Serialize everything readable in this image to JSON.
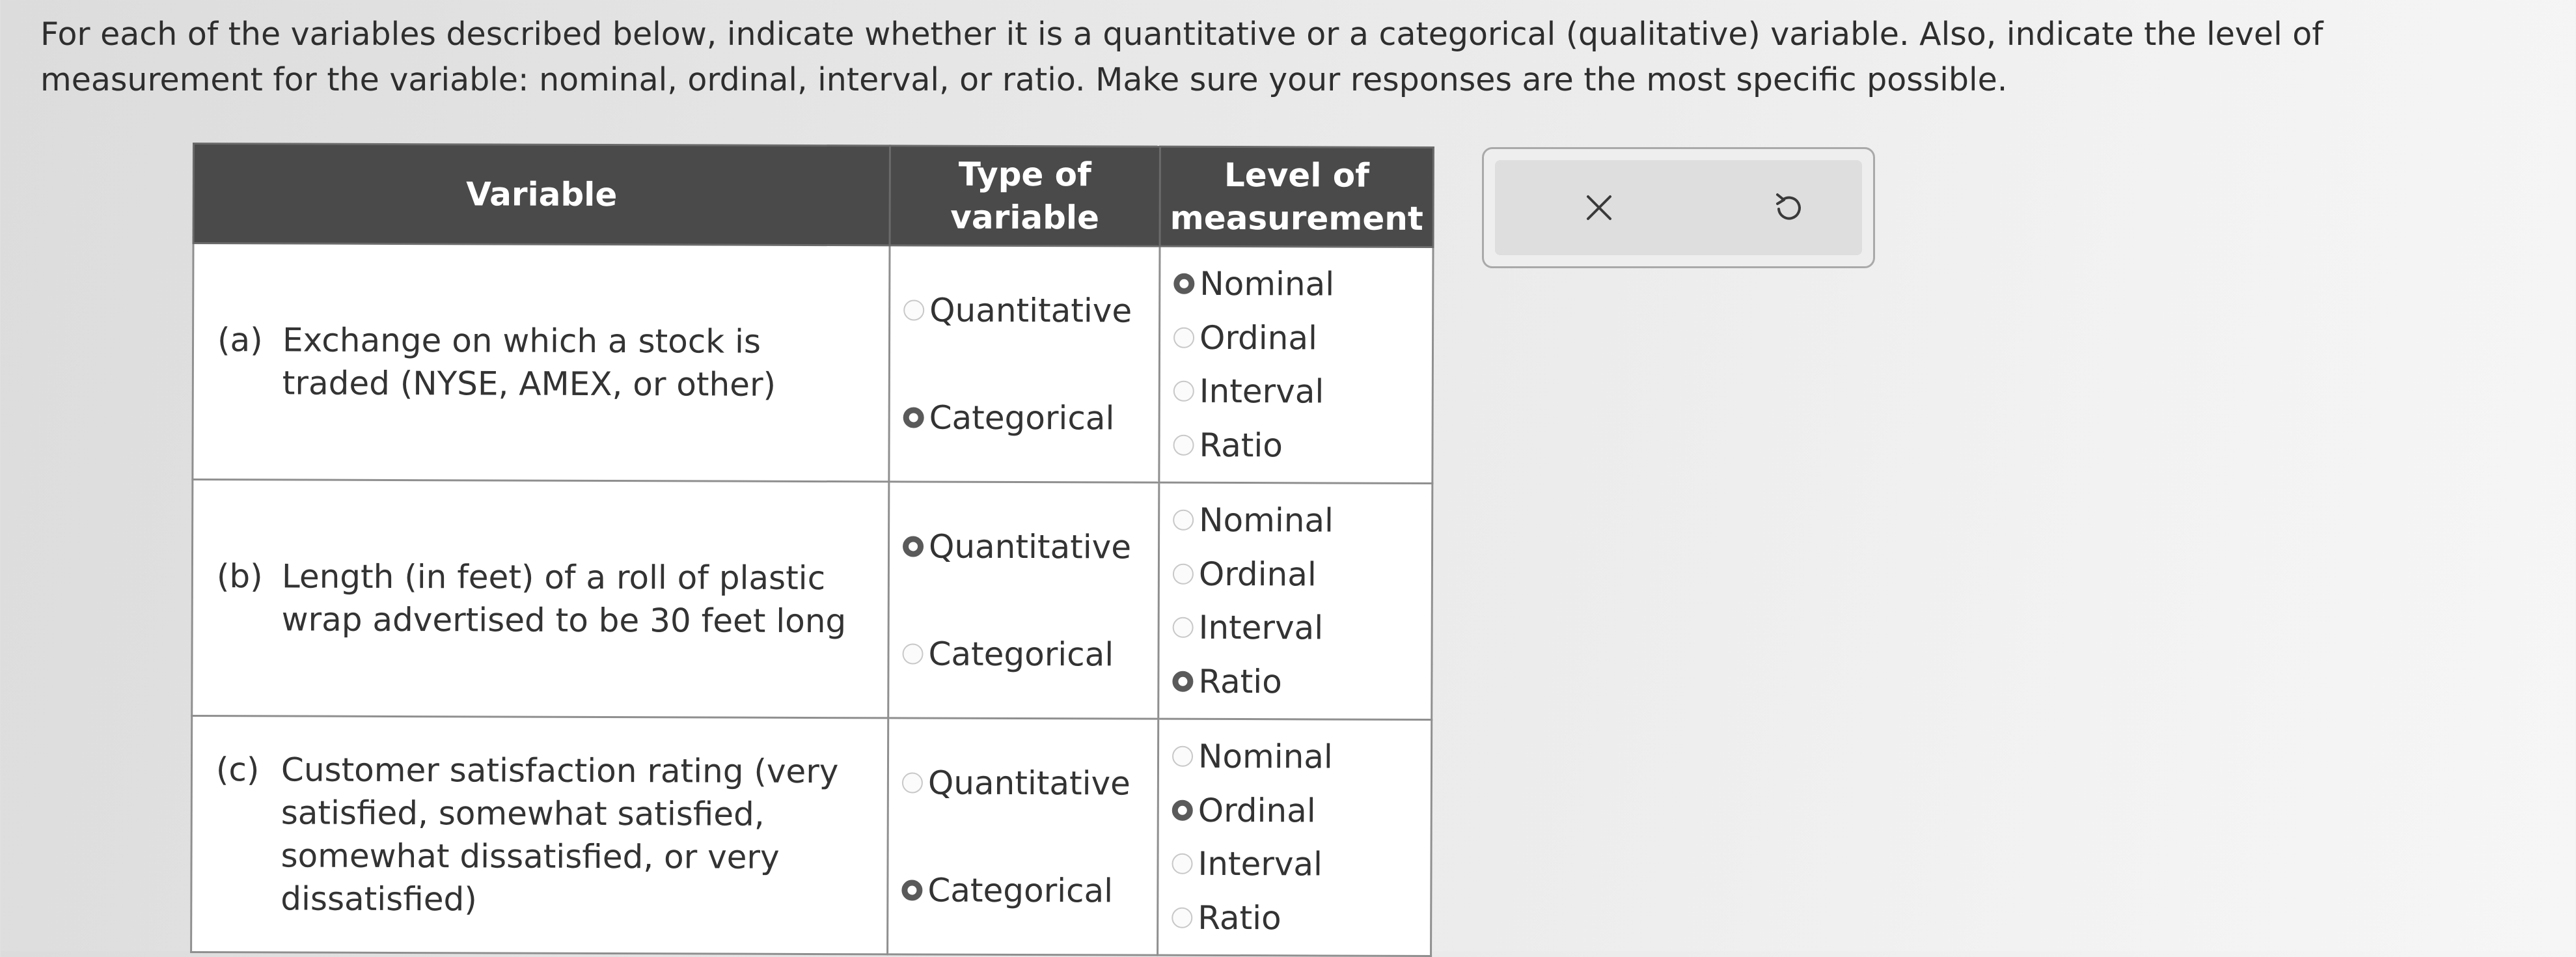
{
  "instructions": "For each of the variables described below, indicate whether it is a quantitative or a categorical (qualitative) variable. Also, indicate the level of measurement for the variable: nominal, ordinal, interval, or ratio. Make sure your responses are the most specific possible.",
  "table": {
    "headers": {
      "variable": "Variable",
      "type_line1": "Type of",
      "type_line2": "variable",
      "level_line1": "Level of",
      "level_line2": "measurement"
    },
    "rows": [
      {
        "prefix": "(a)",
        "description": "Exchange on which a stock is traded (NYSE, AMEX, or other)",
        "type_options": [
          "Quantitative",
          "Categorical"
        ],
        "type_selected": "Categorical",
        "level_options": [
          "Nominal",
          "Ordinal",
          "Interval",
          "Ratio"
        ],
        "level_selected": "Nominal"
      },
      {
        "prefix": "(b)",
        "description": "Length (in feet) of a roll of plastic wrap advertised to be 30 feet long",
        "type_options": [
          "Quantitative",
          "Categorical"
        ],
        "type_selected": "Quantitative",
        "level_options": [
          "Nominal",
          "Ordinal",
          "Interval",
          "Ratio"
        ],
        "level_selected": "Ratio"
      },
      {
        "prefix": "(c)",
        "description": "Customer satisfaction rating (very satisfied, somewhat satisfied, somewhat dissatisfied, or very dissatisfied)",
        "type_options": [
          "Quantitative",
          "Categorical"
        ],
        "type_selected": "Categorical",
        "level_options": [
          "Nominal",
          "Ordinal",
          "Interval",
          "Ratio"
        ],
        "level_selected": "Ordinal"
      }
    ]
  },
  "panel": {
    "icons": [
      "close-icon",
      "undo-icon"
    ]
  }
}
